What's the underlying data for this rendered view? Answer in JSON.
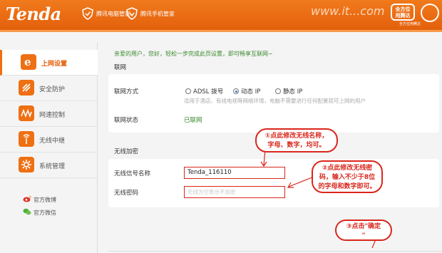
{
  "header": {
    "logo": "Tenda",
    "pc_manager": "腾讯电脑管家",
    "phone_manager": "腾讯手机管家",
    "watermark": "www.it...com",
    "badge": "全方位\n用腾达",
    "badge_sub": "全方位用腾达"
  },
  "colors": {
    "brand": "#ef6f13",
    "annotation": "#d9261c",
    "success": "#3b8a2e"
  },
  "sidebar": {
    "items": [
      {
        "label": "上网设置",
        "icon": "internet-e-icon",
        "active": true
      },
      {
        "label": "安全防护",
        "icon": "shield-stripes-icon",
        "active": false
      },
      {
        "label": "网速控制",
        "icon": "speed-wave-icon",
        "active": false
      },
      {
        "label": "无线中继",
        "icon": "wifi-tower-icon",
        "active": false
      },
      {
        "label": "系统管理",
        "icon": "gear-icon",
        "active": false
      }
    ],
    "social": [
      {
        "label": "官方微博",
        "icon": "weibo-icon"
      },
      {
        "label": "官方微信",
        "icon": "wechat-icon"
      }
    ]
  },
  "main": {
    "greeting": "亲爱的用户，您好，轻松一步完成此页设置，即可畅享互联网~",
    "internet": {
      "title": "联网",
      "mode_label": "联网方式",
      "modes": [
        "ADSL 拨号",
        "动态 IP",
        "静态 IP"
      ],
      "selected_mode": "动态 IP",
      "hint": "适用于酒店、有线电视等网络环境，电脑不需要进行任何配置就可上网的用户",
      "status_label": "联网状态",
      "status_value": "已联网"
    },
    "wireless": {
      "title": "无线加密",
      "ssid_label": "无线信号名称",
      "ssid_value": "Tenda_116110",
      "password_label": "无线密码",
      "password_placeholder": "无线为空表示不加密"
    }
  },
  "annotations": {
    "a1": "①点此修改无线名称，字母、数字，均可。",
    "a1_line1": "①点此修改无线名称，",
    "a1_line2": "字母、数字，均可。",
    "a2_line1": "②点此修改无线密",
    "a2_line2": "码，输入不少于8位",
    "a2_line3": "的字母和数字即可。",
    "a3_line1": "③点击\"确定",
    "a3_line2": "\""
  }
}
